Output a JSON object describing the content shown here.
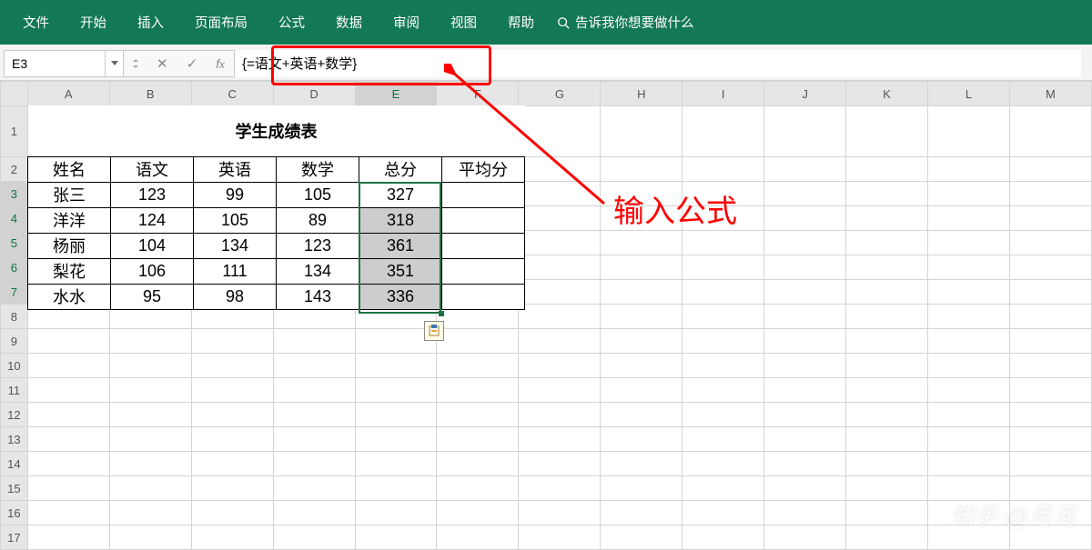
{
  "ribbon": {
    "tabs": [
      "文件",
      "开始",
      "插入",
      "页面布局",
      "公式",
      "数据",
      "审阅",
      "视图",
      "帮助"
    ],
    "search_placeholder": "告诉我你想要做什么"
  },
  "formula_bar": {
    "cell_ref": "E3",
    "formula": "{=语文+英语+数学}"
  },
  "columns": [
    "A",
    "B",
    "C",
    "D",
    "E",
    "F",
    "G",
    "H",
    "I",
    "J",
    "K",
    "L",
    "M"
  ],
  "row_count": 17,
  "selected_col": "E",
  "selected_rows": [
    3,
    4,
    5,
    6,
    7
  ],
  "table": {
    "title": "学生成绩表",
    "headers": [
      "姓名",
      "语文",
      "英语",
      "数学",
      "总分",
      "平均分"
    ],
    "rows": [
      {
        "name": "张三",
        "ch": "123",
        "en": "99",
        "ma": "105",
        "sum": "327",
        "avg": ""
      },
      {
        "name": "洋洋",
        "ch": "124",
        "en": "105",
        "ma": "89",
        "sum": "318",
        "avg": ""
      },
      {
        "name": "杨丽",
        "ch": "104",
        "en": "134",
        "ma": "123",
        "sum": "361",
        "avg": ""
      },
      {
        "name": "梨花",
        "ch": "106",
        "en": "111",
        "ma": "134",
        "sum": "351",
        "avg": ""
      },
      {
        "name": "水水",
        "ch": "95",
        "en": "98",
        "ma": "143",
        "sum": "336",
        "avg": ""
      }
    ]
  },
  "annotation": {
    "label": "输入公式"
  },
  "watermark": "知乎 @月河",
  "chart_data": {
    "type": "table",
    "title": "学生成绩表",
    "columns": [
      "姓名",
      "语文",
      "英语",
      "数学",
      "总分",
      "平均分"
    ],
    "rows": [
      [
        "张三",
        123,
        99,
        105,
        327,
        null
      ],
      [
        "洋洋",
        124,
        105,
        89,
        318,
        null
      ],
      [
        "杨丽",
        104,
        134,
        123,
        361,
        null
      ],
      [
        "梨花",
        106,
        111,
        134,
        351,
        null
      ],
      [
        "水水",
        95,
        98,
        143,
        336,
        null
      ]
    ]
  }
}
